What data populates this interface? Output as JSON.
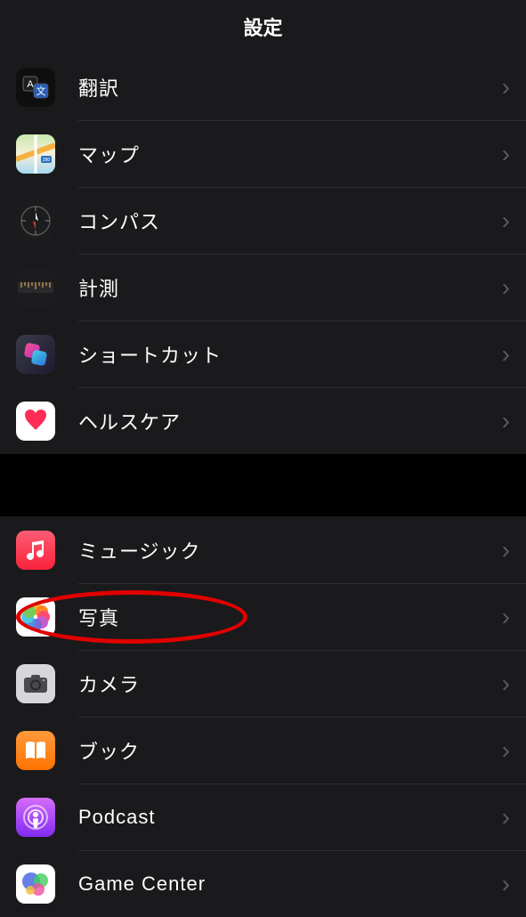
{
  "header": {
    "title": "設定"
  },
  "group1": {
    "items": [
      {
        "label": "翻訳",
        "icon": "translate-icon"
      },
      {
        "label": "マップ",
        "icon": "maps-icon"
      },
      {
        "label": "コンパス",
        "icon": "compass-icon"
      },
      {
        "label": "計測",
        "icon": "measure-icon"
      },
      {
        "label": "ショートカット",
        "icon": "shortcuts-icon"
      },
      {
        "label": "ヘルスケア",
        "icon": "health-icon"
      }
    ]
  },
  "group2": {
    "items": [
      {
        "label": "ミュージック",
        "icon": "music-icon"
      },
      {
        "label": "写真",
        "icon": "photos-icon",
        "annotated": true
      },
      {
        "label": "カメラ",
        "icon": "camera-icon"
      },
      {
        "label": "ブック",
        "icon": "books-icon"
      },
      {
        "label": "Podcast",
        "icon": "podcast-icon"
      },
      {
        "label": "Game Center",
        "icon": "gamecenter-icon"
      }
    ]
  }
}
